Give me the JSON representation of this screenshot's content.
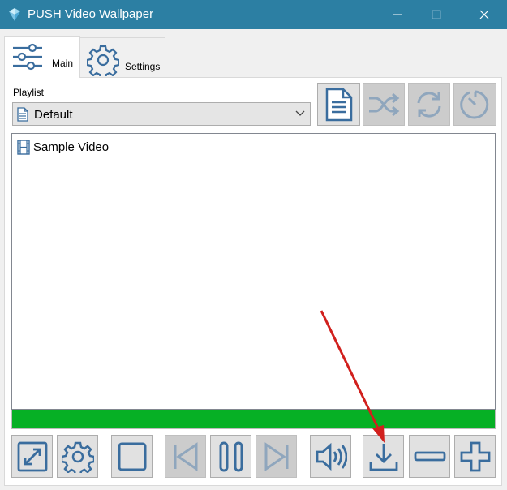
{
  "window": {
    "title": "PUSH Video Wallpaper"
  },
  "tabs": [
    {
      "label": "Main",
      "icon": "sliders-icon",
      "selected": true
    },
    {
      "label": "Settings",
      "icon": "gear-icon",
      "selected": false
    }
  ],
  "playlist": {
    "label": "Playlist",
    "selected": "Default"
  },
  "videos": [
    {
      "title": "Sample Video"
    }
  ],
  "progress": {
    "fraction": 1.0,
    "color": "#06b025"
  },
  "colors": {
    "titlebar": "#2c7fa3",
    "icon_blue": "#3a6d9e",
    "arrow": "#d1201d"
  }
}
